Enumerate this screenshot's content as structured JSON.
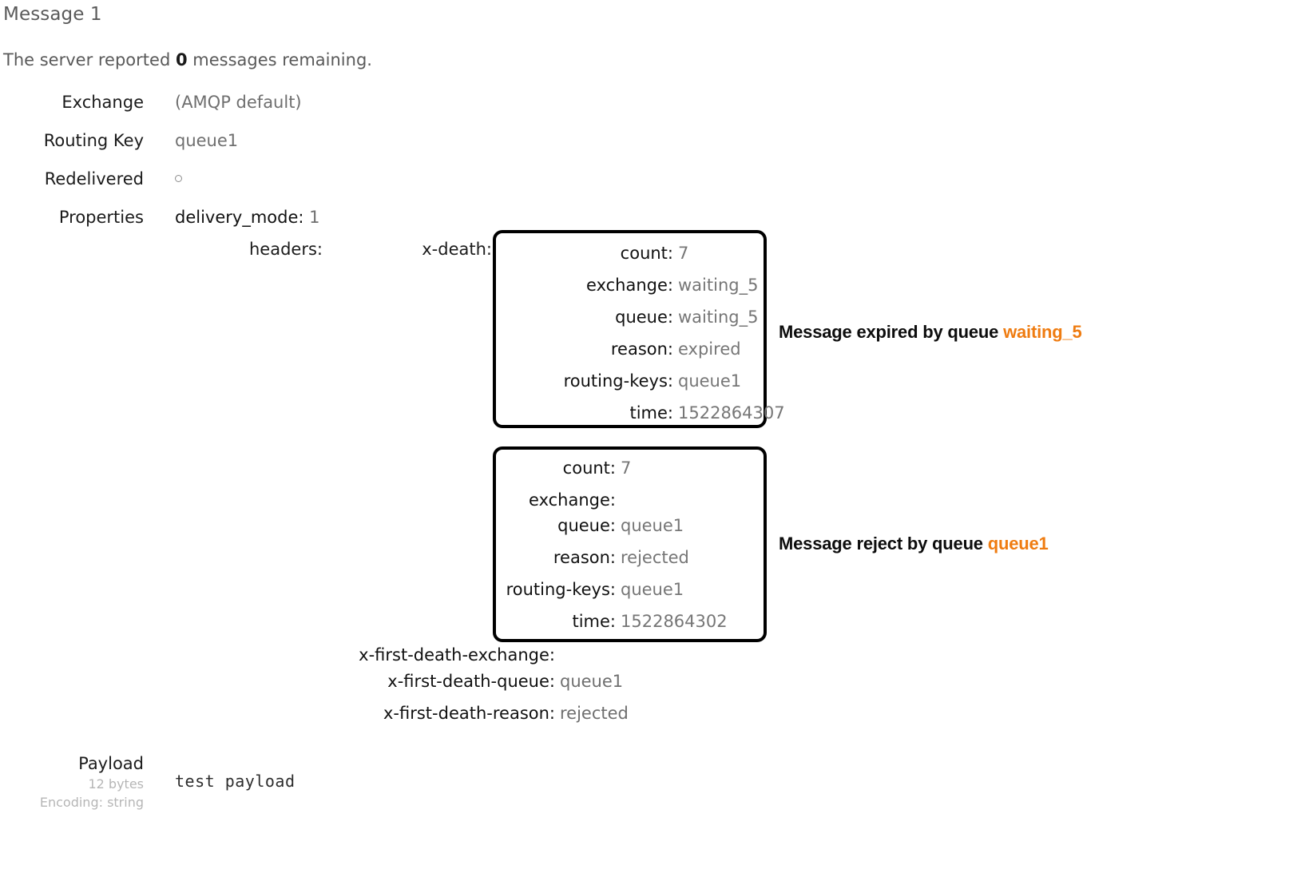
{
  "message": {
    "title": "Message 1",
    "server_notice_prefix": "The server reported ",
    "server_notice_count": "0",
    "server_notice_suffix": " messages remaining."
  },
  "properties_table": {
    "rows": [
      {
        "label": "Exchange",
        "value": "(AMQP default)"
      },
      {
        "label": "Routing Key",
        "value": "queue1"
      },
      {
        "label": "Redelivered",
        "value": ""
      },
      {
        "label": "Properties",
        "value": "delivery_mode: 1"
      }
    ],
    "delivery_mode_key": "delivery_mode:",
    "delivery_mode_value": "1"
  },
  "headers": {
    "label": "headers:",
    "x_death_label": "x-death:",
    "entries": [
      {
        "name": "x-death-entry-1",
        "rows": [
          {
            "key": "count:",
            "value": "7"
          },
          {
            "key": "exchange:",
            "value": "waiting_5"
          },
          {
            "key": "queue:",
            "value": "waiting_5"
          },
          {
            "key": "reason:",
            "value": "expired"
          },
          {
            "key": "routing-keys:",
            "value": "queue1"
          },
          {
            "key": "time:",
            "value": "1522864307"
          }
        ]
      },
      {
        "name": "x-death-entry-2",
        "rows": [
          {
            "key": "count:",
            "value": "7"
          },
          {
            "key": "exchange:",
            "value": ""
          },
          {
            "key": "queue:",
            "value": "queue1"
          },
          {
            "key": "reason:",
            "value": "rejected"
          },
          {
            "key": "routing-keys:",
            "value": "queue1"
          },
          {
            "key": "time:",
            "value": "1522864302"
          }
        ]
      }
    ],
    "first_death": [
      {
        "key": "x-first-death-exchange:",
        "value": ""
      },
      {
        "key": "x-first-death-queue:",
        "value": "queue1"
      },
      {
        "key": "x-first-death-reason:",
        "value": "rejected"
      }
    ]
  },
  "annotations": [
    {
      "name": "annotation-expired",
      "text": "Message expired by queue ",
      "highlight": "waiting_5"
    },
    {
      "name": "annotation-rejected",
      "text": "Message reject by queue ",
      "highlight": "queue1"
    }
  ],
  "payload": {
    "label": "Payload",
    "size": "12 bytes",
    "encoding": "Encoding: string",
    "body": "test payload"
  },
  "colors": {
    "highlight": "#ef7c11",
    "key_text": "#111111",
    "value_text": "#767676",
    "box_border": "#000000"
  }
}
